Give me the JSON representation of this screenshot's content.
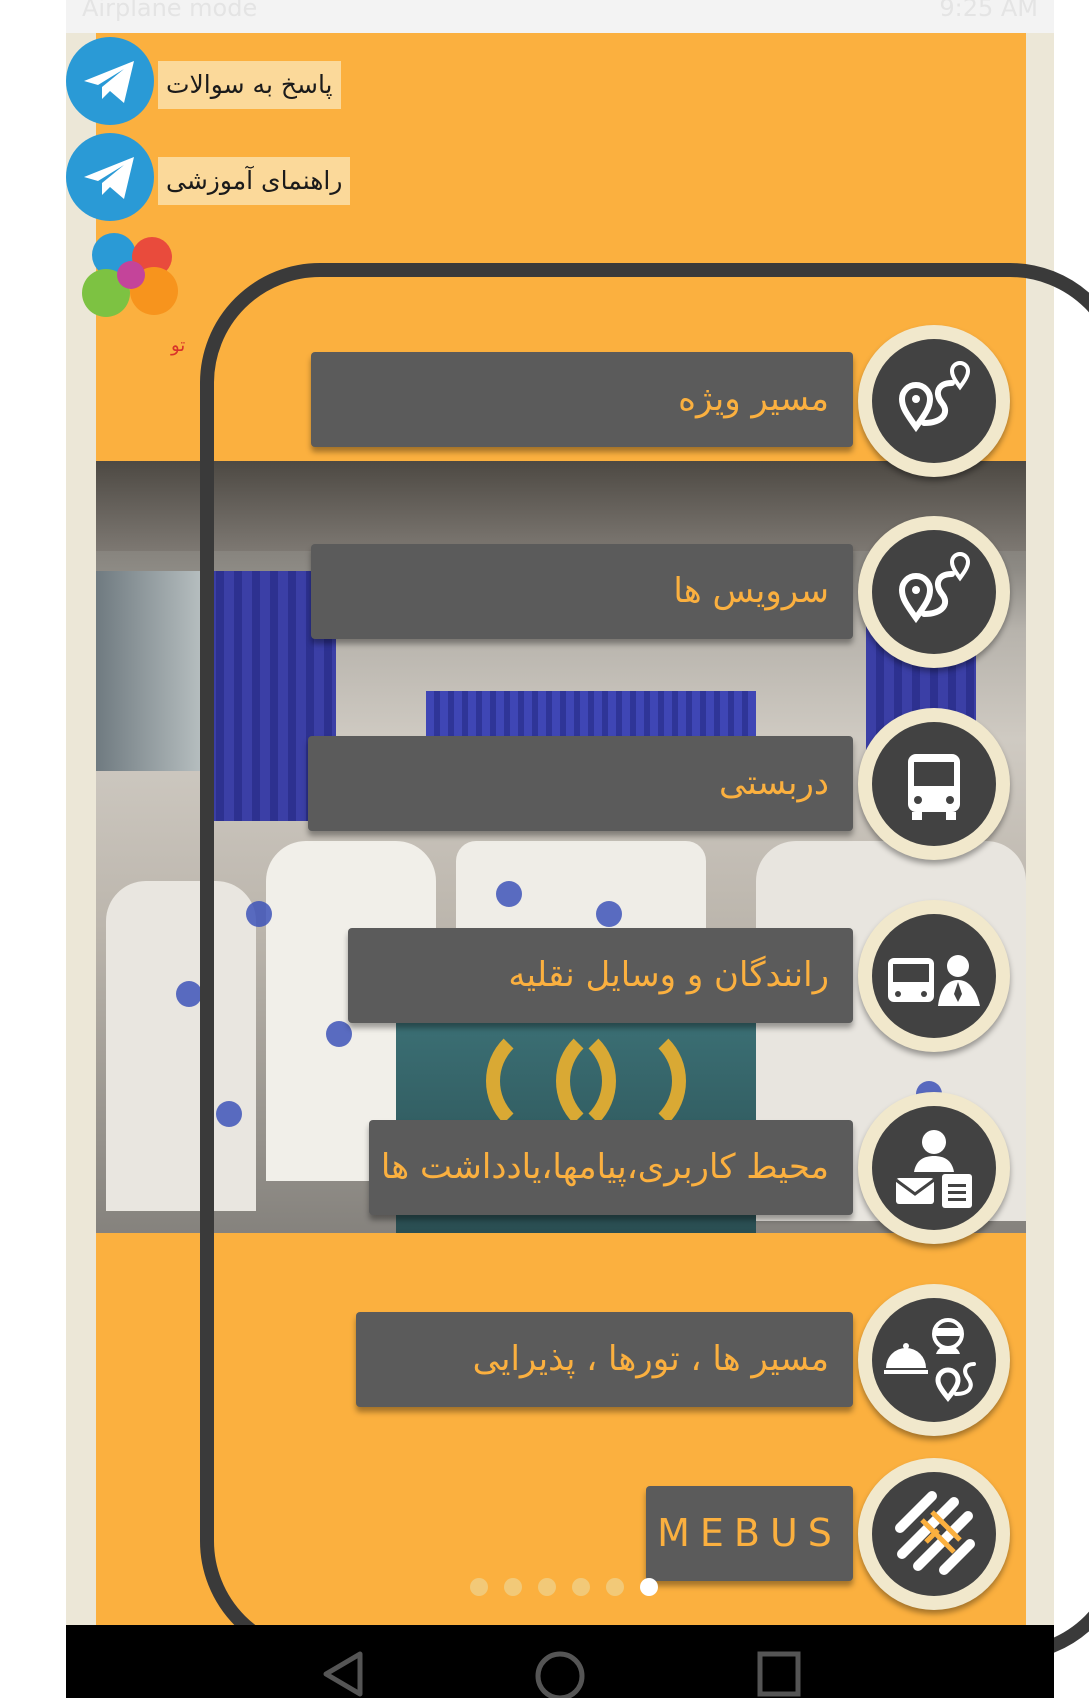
{
  "status_bar": {
    "left_text": "Airplane mode",
    "right_text": "9:25 AM"
  },
  "help_links": [
    {
      "label": "پاسخ به سوالات",
      "icon": "telegram-icon"
    },
    {
      "label": "راهنمای آموزشی",
      "icon": "telegram-icon"
    }
  ],
  "logo": {
    "text": "تهران با تو"
  },
  "menu": {
    "items": [
      {
        "label": "مسیر ویژه",
        "icon": "route-pin-icon"
      },
      {
        "label": "سرویس ها",
        "icon": "route-pin-icon"
      },
      {
        "label": "دربستی",
        "icon": "bus-icon"
      },
      {
        "label": "رانندگان و وسایل نقلیه",
        "icon": "bus-driver-icon"
      },
      {
        "label": "محیط کاربری،پیامها،یادداشت ها",
        "icon": "user-messages-notes-icon"
      },
      {
        "label": "مسیر ها ، تورها ، پذیرایی",
        "icon": "tours-catering-icon"
      },
      {
        "label": "MEBUS",
        "icon": "mebus-logo-icon"
      }
    ]
  },
  "pager": {
    "count": 6,
    "active_index": 5
  },
  "colors": {
    "background": "#fbb03f",
    "button": "#5b5b5b",
    "button_text": "#fbb03f",
    "icon_ring": "#f1e8cc",
    "icon_fill": "#424242",
    "telegram": "#2a9ad6",
    "frame": "#3a3a3a"
  },
  "nav_bar": {
    "icons": [
      "back-icon",
      "home-icon",
      "recents-icon"
    ]
  }
}
